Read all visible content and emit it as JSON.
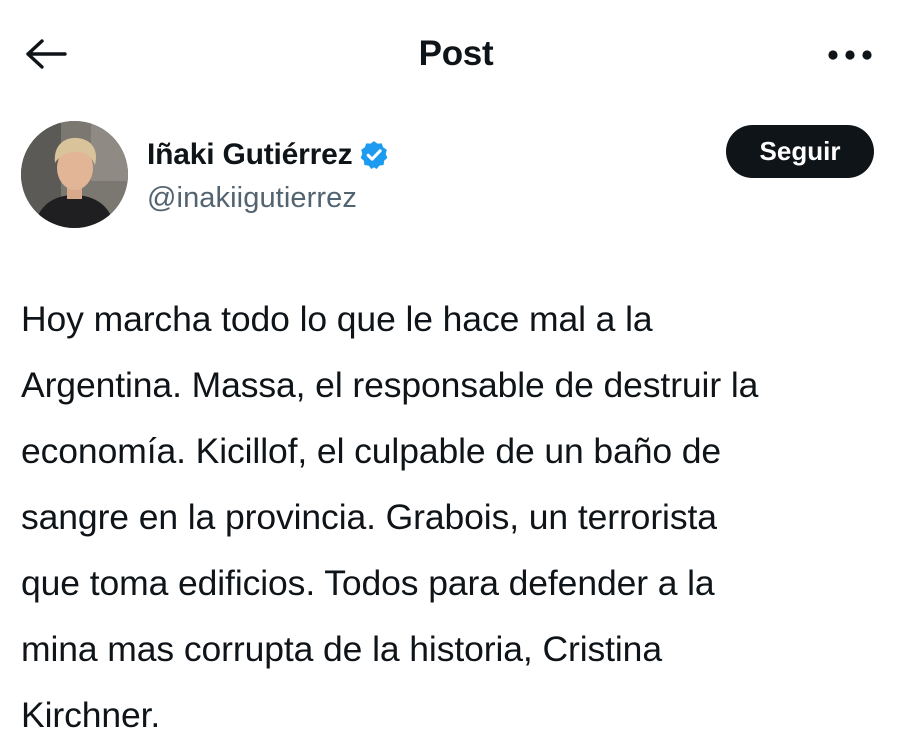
{
  "header": {
    "title": "Post",
    "back_icon": "arrow-left-icon",
    "more_icon": "more-horizontal-icon"
  },
  "author": {
    "display_name": "Iñaki Gutiérrez",
    "handle": "@inakiigutierrez",
    "verified_icon": "verified-badge-icon",
    "verified_color": "#1d9bf0",
    "follow_label": "Seguir"
  },
  "tweet": {
    "lines": [
      "Hoy marcha todo lo que le hace mal a la",
      "Argentina. Massa, el responsable de destruir la",
      "economía. Kicillof, el culpable de un baño de",
      "sangre en la provincia. Grabois, un terrorista",
      "que toma edificios. Todos para defender a la",
      "mina mas corrupta de la historia, Cristina",
      "Kirchner."
    ]
  }
}
